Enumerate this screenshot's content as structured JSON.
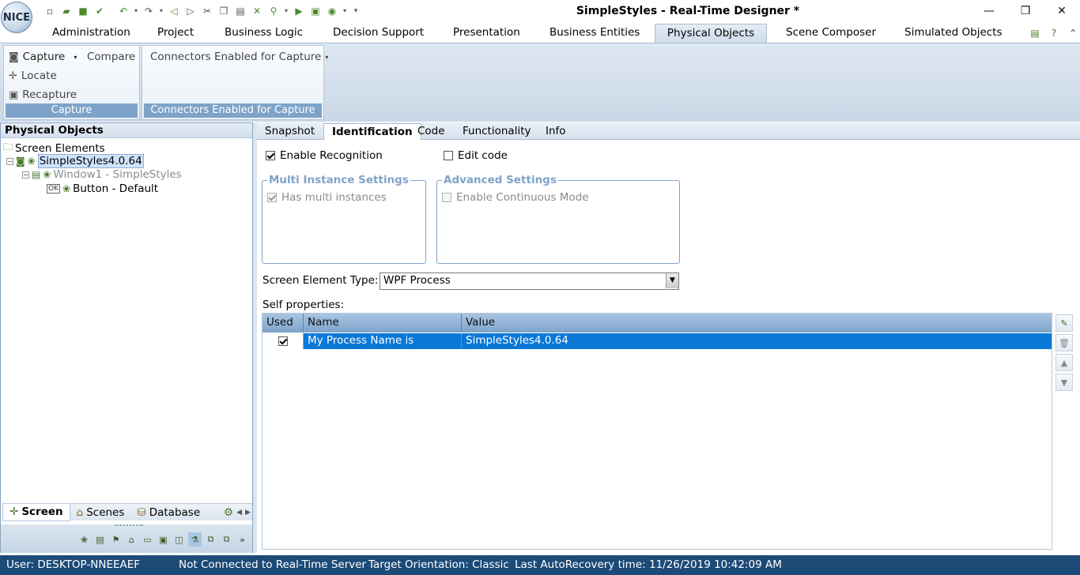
{
  "app": {
    "logo_text": "NICE",
    "title": "SimpleStyles - Real-Time Designer *",
    "window_controls": [
      "minimize-icon",
      "restore-icon",
      "close-icon"
    ]
  },
  "quick_access": [
    "new-icon",
    "open-icon",
    "save-icon",
    "save-check-icon",
    "undo-icon",
    "redo-icon",
    "back-icon",
    "forward-icon",
    "cut-icon",
    "copy-icon",
    "paste-icon",
    "delete-icon",
    "find-icon",
    "run-icon",
    "deploy-icon",
    "capture-icon",
    "customize-icon"
  ],
  "menu": {
    "tabs": [
      "Administration",
      "Project",
      "Business Logic",
      "Decision Support",
      "Presentation",
      "Business Entities",
      "Physical Objects",
      "Scene Composer",
      "Simulated Objects"
    ],
    "active": "Physical Objects",
    "right_icons": [
      "copy-doc-icon",
      "help-icon",
      "collapse-ribbon-icon"
    ]
  },
  "ribbon": {
    "capture_group": {
      "capture": "Capture",
      "compare": "Compare",
      "locate": "Locate",
      "recapture": "Recapture",
      "title": "Capture"
    },
    "connectors_group": {
      "dropdown": "Connectors Enabled for Capture",
      "title": "Connectors Enabled for Capture"
    }
  },
  "left_pane": {
    "header": "Physical Objects",
    "tree": {
      "root": "Screen Elements",
      "app": "SimpleStyles4.0.64",
      "window": "Window1 - SimpleStyles",
      "button": "Button - Default"
    },
    "bottom_tabs": [
      "Screen",
      "Scenes",
      "Database"
    ]
  },
  "right_pane": {
    "tabs": [
      "Snapshot",
      "Identification",
      "Code",
      "Functionality",
      "Info"
    ],
    "active_tab": "Identification",
    "enable_recognition": {
      "label": "Enable Recognition",
      "checked": true
    },
    "edit_code": {
      "label": "Edit code",
      "checked": false
    },
    "multi_instance": {
      "title": "Multi Instance Settings",
      "has_multi": {
        "label": "Has multi instances",
        "checked": true,
        "disabled": true
      }
    },
    "advanced": {
      "title": "Advanced Settings",
      "continuous": {
        "label": "Enable Continuous Mode",
        "checked": false,
        "disabled": true
      }
    },
    "element_type": {
      "label": "Screen Element Type:",
      "value": "WPF Process"
    },
    "self_properties": {
      "label": "Self properties:",
      "columns": [
        "Used",
        "Name",
        "Value"
      ],
      "rows": [
        {
          "used": true,
          "name": "My Process Name is",
          "value": "SimpleStyles4.0.64"
        }
      ]
    }
  },
  "status": {
    "user": "User: DESKTOP-NNEEAEF",
    "connection": "Not Connected to Real-Time Server",
    "orientation": "Target Orientation: Classic",
    "autorecovery": "Last AutoRecovery time: 11/26/2019 10:42:09 AM"
  },
  "colors": {
    "selection": "#0a78d7",
    "status_bar": "#1d4b78",
    "group_title": "#7ea3c9"
  }
}
